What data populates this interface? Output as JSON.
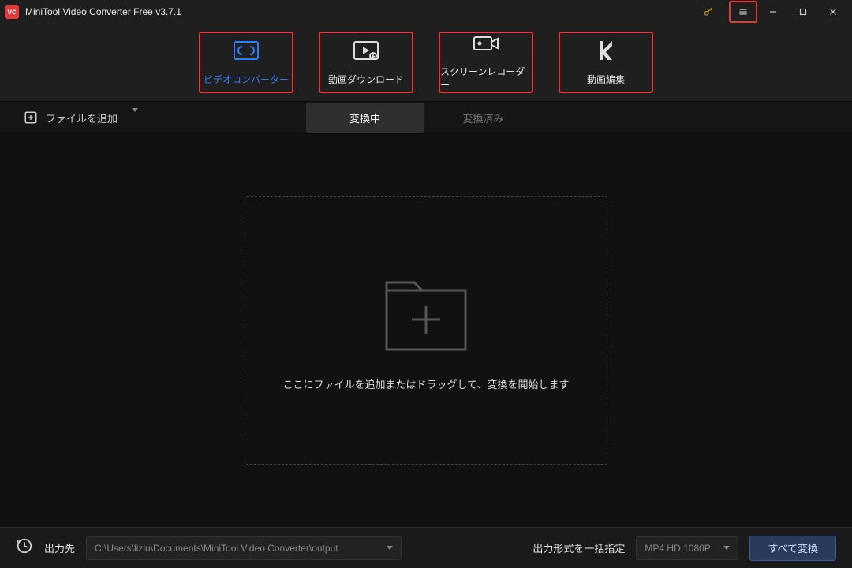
{
  "titlebar": {
    "app_title": "MiniTool Video Converter Free v3.7.1"
  },
  "nav": {
    "converter": "ビデオコンバーター",
    "download": "動画ダウンロード",
    "recorder": "スクリーンレコーダー",
    "editor": "動画編集"
  },
  "toolbar": {
    "add_file": "ファイルを追加",
    "tab_converting": "変換中",
    "tab_converted": "変換済み"
  },
  "dropzone": {
    "message": "ここにファイルを追加またはドラッグして、変換を開始します"
  },
  "bottom": {
    "output_label": "出力先",
    "output_path": "C:\\Users\\lizlu\\Documents\\MiniTool Video Converter\\output",
    "format_label": "出力形式を一括指定",
    "format_value": "MP4 HD 1080P",
    "convert_all": "すべて変換"
  }
}
